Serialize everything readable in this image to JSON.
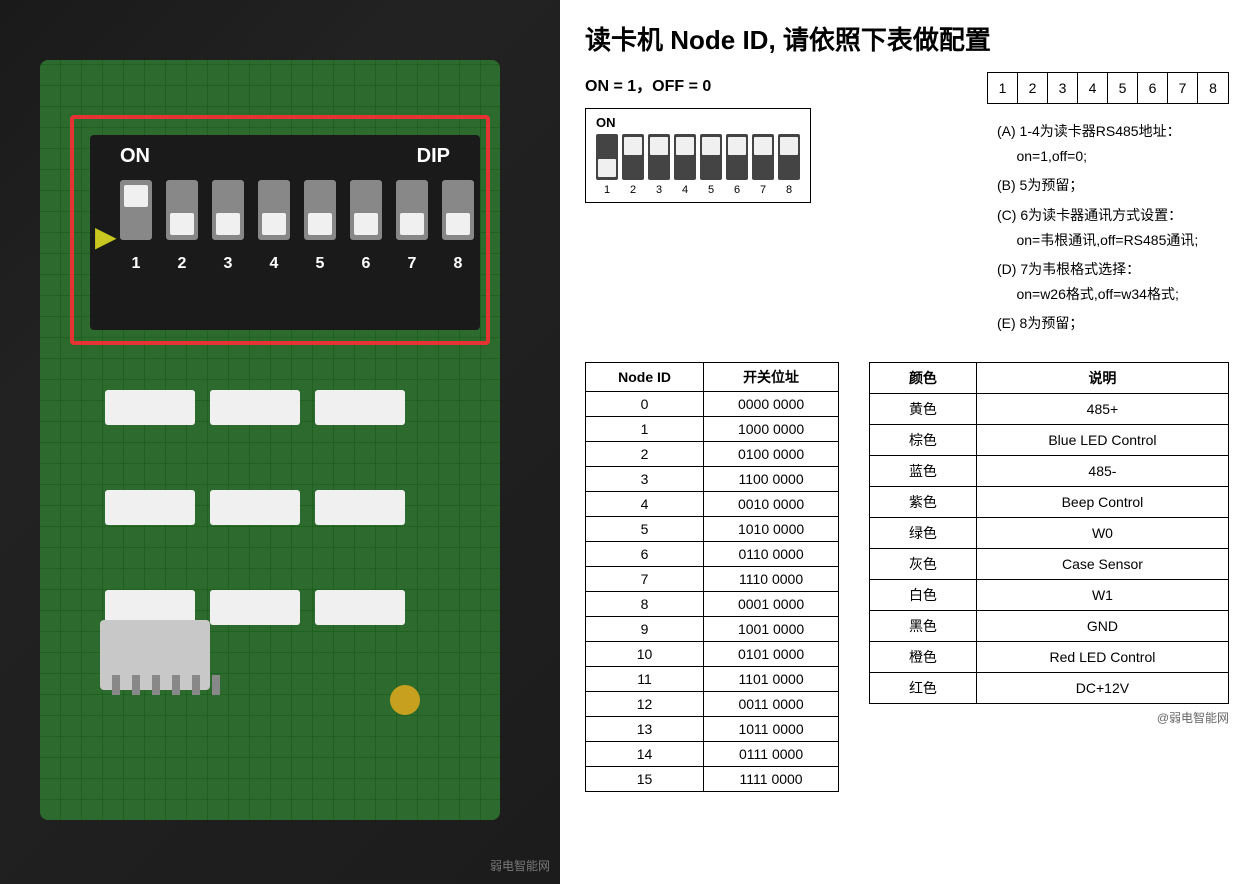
{
  "left": {
    "dip_switches": [
      "on",
      "off",
      "off",
      "off",
      "off",
      "off",
      "off",
      "off"
    ],
    "dip_numbers": [
      "1",
      "2",
      "3",
      "4",
      "5",
      "6",
      "7",
      "8"
    ]
  },
  "right": {
    "title": "读卡机 Node ID, 请依照下表做配置",
    "on_off_label": "ON = 1，OFF = 0",
    "dip_on_label": "ON",
    "dip_nums": [
      "1",
      "2",
      "3",
      "4",
      "5",
      "6",
      "7",
      "8"
    ],
    "num_boxes": [
      "1",
      "2",
      "3",
      "4",
      "5",
      "6",
      "7",
      "8"
    ],
    "notes": [
      "(A)  1-4为读卡器RS485地址：on=1,off=0;",
      "(B)  5为预留；",
      "(C)  6为读卡器通讯方式设置：on=韦根通讯,off=RS485通讯;",
      "(D)  7为韦根格式选择：on=w26格式,off=w34格式;",
      "(E)  8为预留；"
    ],
    "node_table": {
      "headers": [
        "Node ID",
        "开关位址"
      ],
      "rows": [
        [
          "0",
          "0000 0000"
        ],
        [
          "1",
          "1000 0000"
        ],
        [
          "2",
          "0100 0000"
        ],
        [
          "3",
          "1100 0000"
        ],
        [
          "4",
          "0010 0000"
        ],
        [
          "5",
          "1010 0000"
        ],
        [
          "6",
          "0110 0000"
        ],
        [
          "7",
          "1110 0000"
        ],
        [
          "8",
          "0001 0000"
        ],
        [
          "9",
          "1001 0000"
        ],
        [
          "10",
          "0101 0000"
        ],
        [
          "11",
          "1101 0000"
        ],
        [
          "12",
          "0011 0000"
        ],
        [
          "13",
          "1011 0000"
        ],
        [
          "14",
          "0111 0000"
        ],
        [
          "15",
          "1111 0000"
        ]
      ]
    },
    "color_table": {
      "headers": [
        "颜色",
        "说明"
      ],
      "rows": [
        [
          "黄色",
          "485+"
        ],
        [
          "棕色",
          "Blue LED Control"
        ],
        [
          "蓝色",
          "485-"
        ],
        [
          "紫色",
          "Beep Control"
        ],
        [
          "绿色",
          "W0"
        ],
        [
          "灰色",
          "Case Sensor"
        ],
        [
          "白色",
          "W1"
        ],
        [
          "黑色",
          "GND"
        ],
        [
          "橙色",
          "Red LED Control"
        ],
        [
          "红色",
          "DC+12V"
        ]
      ]
    },
    "watermark": "@弱电智能网"
  }
}
